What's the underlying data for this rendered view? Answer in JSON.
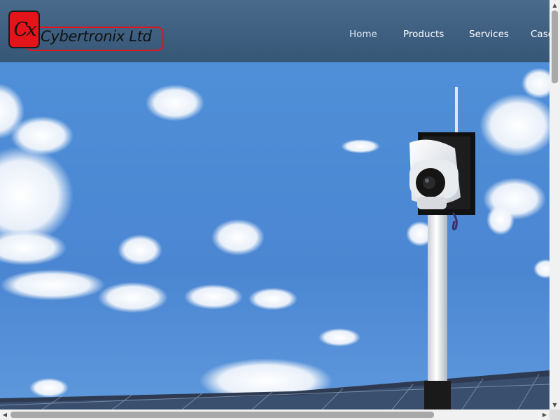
{
  "header": {
    "logo": {
      "mark": "Cx",
      "name": "Cybertronix Ltd"
    },
    "nav": [
      {
        "label": "Home",
        "active": true
      },
      {
        "label": "Products"
      },
      {
        "label": "Services"
      },
      {
        "label": "Case"
      }
    ]
  },
  "hero": {
    "image": "solar-cctv-camera-on-pole-over-solar-panels"
  },
  "colors": {
    "header": "#3e5f80",
    "logo_red": "#e3141a",
    "sky": "#4d8bd6"
  }
}
